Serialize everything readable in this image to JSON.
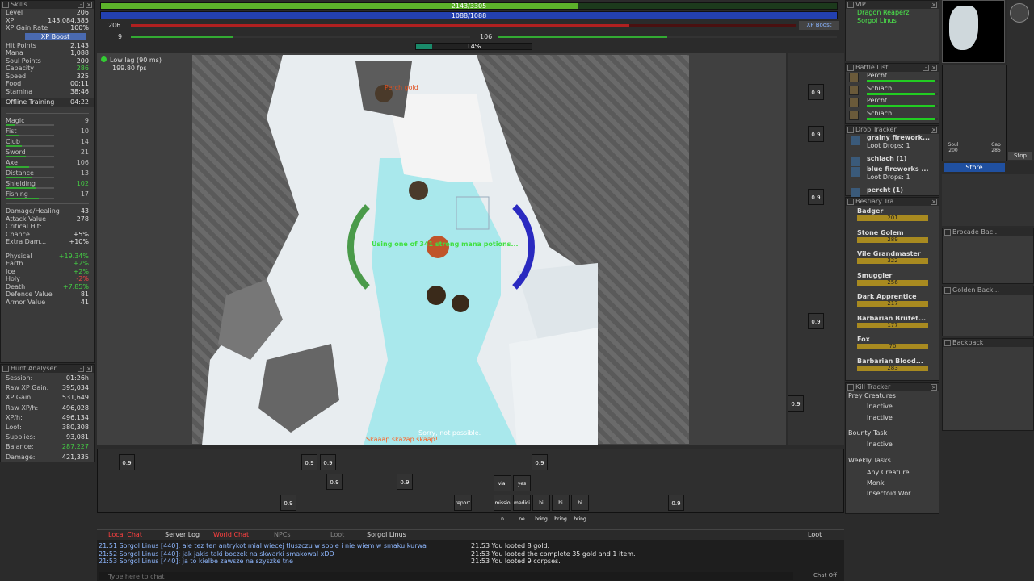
{
  "skills": {
    "title": "Skills",
    "stats": [
      {
        "label": "Level",
        "value": "206"
      },
      {
        "label": "XP",
        "value": "143,084,385"
      },
      {
        "label": "XP Gain Rate",
        "value": "100%"
      }
    ],
    "xp_boost": "XP Boost",
    "stats2": [
      {
        "label": "Hit Points",
        "value": "2,143"
      },
      {
        "label": "Mana",
        "value": "1,088"
      },
      {
        "label": "Soul Points",
        "value": "200"
      },
      {
        "label": "Capacity",
        "value": "286"
      },
      {
        "label": "Speed",
        "value": "325"
      },
      {
        "label": "Food",
        "value": "00:11"
      },
      {
        "label": "Stamina",
        "value": "38:46"
      }
    ],
    "offline_training": {
      "label": "Offline Training",
      "value": "04:22"
    },
    "skill_list": [
      {
        "label": "Magic",
        "value": "9"
      },
      {
        "label": "Fist",
        "value": "10"
      },
      {
        "label": "Club",
        "value": "14"
      },
      {
        "label": "Sword",
        "value": "21"
      },
      {
        "label": "Axe",
        "value": "106"
      },
      {
        "label": "Distance",
        "value": "13"
      },
      {
        "label": "Shielding",
        "value": "102"
      },
      {
        "label": "Fishing",
        "value": "17"
      }
    ],
    "combat": [
      {
        "label": "Damage/Healing",
        "value": "43"
      },
      {
        "label": "Attack Value",
        "value": "278"
      },
      {
        "label": "Critical Hit:",
        "value": ""
      },
      {
        "label": "Chance",
        "value": "+5%"
      },
      {
        "label": "Extra Dam...",
        "value": "+10%"
      }
    ],
    "resist": [
      {
        "label": "Physical",
        "value": "+19.34%"
      },
      {
        "label": "Earth",
        "value": "+2%"
      },
      {
        "label": "Ice",
        "value": "+2%"
      },
      {
        "label": "Holy",
        "value": "-2%"
      },
      {
        "label": "Death",
        "value": "+7.85%"
      },
      {
        "label": "Defence Value",
        "value": "81"
      },
      {
        "label": "Armor Value",
        "value": "41"
      }
    ]
  },
  "hunt": {
    "title": "Hunt Analyser",
    "rows": [
      {
        "label": "Session:",
        "value": "01:26h"
      },
      {
        "label": "Raw XP Gain:",
        "value": "395,034"
      },
      {
        "label": "XP Gain:",
        "value": "531,649"
      },
      {
        "label": "Raw XP/h:",
        "value": "496,028"
      },
      {
        "label": "XP/h:",
        "value": "496,134"
      },
      {
        "label": "Loot:",
        "value": "380,308"
      },
      {
        "label": "Supplies:",
        "value": "93,081"
      },
      {
        "label": "Balance:",
        "value": "287,227"
      },
      {
        "label": "Damage:",
        "value": "421,335"
      }
    ]
  },
  "top": {
    "hp": "2143/3305",
    "mana": "1088/1088",
    "level_left": "206",
    "level2_left": "9",
    "level2_right": "106",
    "xp_boost": "XP Boost",
    "percent": "14%",
    "hp_fraction": 0.648,
    "mana_fraction": 1.0
  },
  "game": {
    "lag": "Low lag (90 ms)",
    "fps": "199.80 fps",
    "player_names": [
      "Perch gold"
    ],
    "center_msg": "Using one of 341 strong mana potions...",
    "sorry": "Sorry, not possible.",
    "yell": "Skaaap skazap skaap!"
  },
  "vip": {
    "title": "VIP",
    "friends": [
      "Dragon Reaperz",
      "Sorgol Linus"
    ]
  },
  "battle": {
    "title": "Battle List",
    "entries": [
      {
        "name": "Percht",
        "hp": 0.95
      },
      {
        "name": "Schiach",
        "hp": 0.95
      },
      {
        "name": "Percht",
        "hp": 0.95
      },
      {
        "name": "Schiach",
        "hp": 0.95
      }
    ]
  },
  "drop": {
    "title": "Drop Tracker",
    "entries": [
      {
        "name": "grainy firework...",
        "sub": "Loot Drops: 1"
      },
      {
        "name": "schiach (1)",
        "sub": ""
      },
      {
        "name": "blue fireworks ...",
        "sub": "Loot Drops: 1"
      },
      {
        "name": "percht (1)",
        "sub": ""
      }
    ]
  },
  "bestiary": {
    "title": "Bestiary Tra...",
    "entries": [
      {
        "name": "Badger",
        "count": "201"
      },
      {
        "name": "Stone Golem",
        "count": "289"
      },
      {
        "name": "Vile Grandmaster",
        "count": "322"
      },
      {
        "name": "Smuggler",
        "count": "256"
      },
      {
        "name": "Dark Apprentice",
        "count": "217"
      },
      {
        "name": "Barbarian Brutet...",
        "count": "177"
      },
      {
        "name": "Fox",
        "count": "70"
      },
      {
        "name": "Barbarian Blood...",
        "count": "283"
      }
    ]
  },
  "kill": {
    "title": "Kill Tracker",
    "prey": "Prey Creatures",
    "inactive": "Inactive",
    "bounty": "Bounty Task",
    "weekly": "Weekly Tasks",
    "tasks": [
      "Any Creature",
      "Monk",
      "Insectoid Wor..."
    ]
  },
  "containers": {
    "store": "Store",
    "brocade": "Brocade Bac...",
    "golden": "Golden Back...",
    "backpack": "Backpack",
    "soul": "Soul 200",
    "cap": "Cap 286",
    "stop": "Stop"
  },
  "chat": {
    "tabs": [
      "Local Chat",
      "Server Log",
      "World Chat",
      "NPCs",
      "Loot",
      "Sorgol Linus"
    ],
    "loot_tab": "Loot",
    "left": [
      "21:51 Sorgol Linus [440]: ale tez ten antrykot mial wiecej tluszczu w sobie i nie wiem w smaku kurwa",
      "21:52 Sorgol Linus [440]: jak jakis taki boczek na skwarki smakowal xDD",
      "21:53 Sorgol Linus [440]: ja to kielbe zawsze na szyszke tne"
    ],
    "right": [
      "21:53 You looted 8 gold.",
      "21:53 You looted the complete 35 gold and 1 item.",
      "21:53 You looted 9 corpses."
    ],
    "placeholder": "Type here to chat",
    "chat_off": "Chat Off"
  },
  "hotbar": {
    "values": [
      "0.9",
      "0.9",
      "0.9",
      "0.9",
      "0.9",
      "0.9",
      "0.9",
      "0.9"
    ],
    "labels": [
      "vial",
      "yes",
      "report",
      "missio n",
      "medici ne pouch",
      "hi bring me t...",
      "hi bring me t...",
      "hi bring me t..."
    ]
  },
  "side_hotbar": {
    "values": [
      "0.9",
      "0.9",
      "0.9",
      "0.9",
      "0.9"
    ]
  }
}
